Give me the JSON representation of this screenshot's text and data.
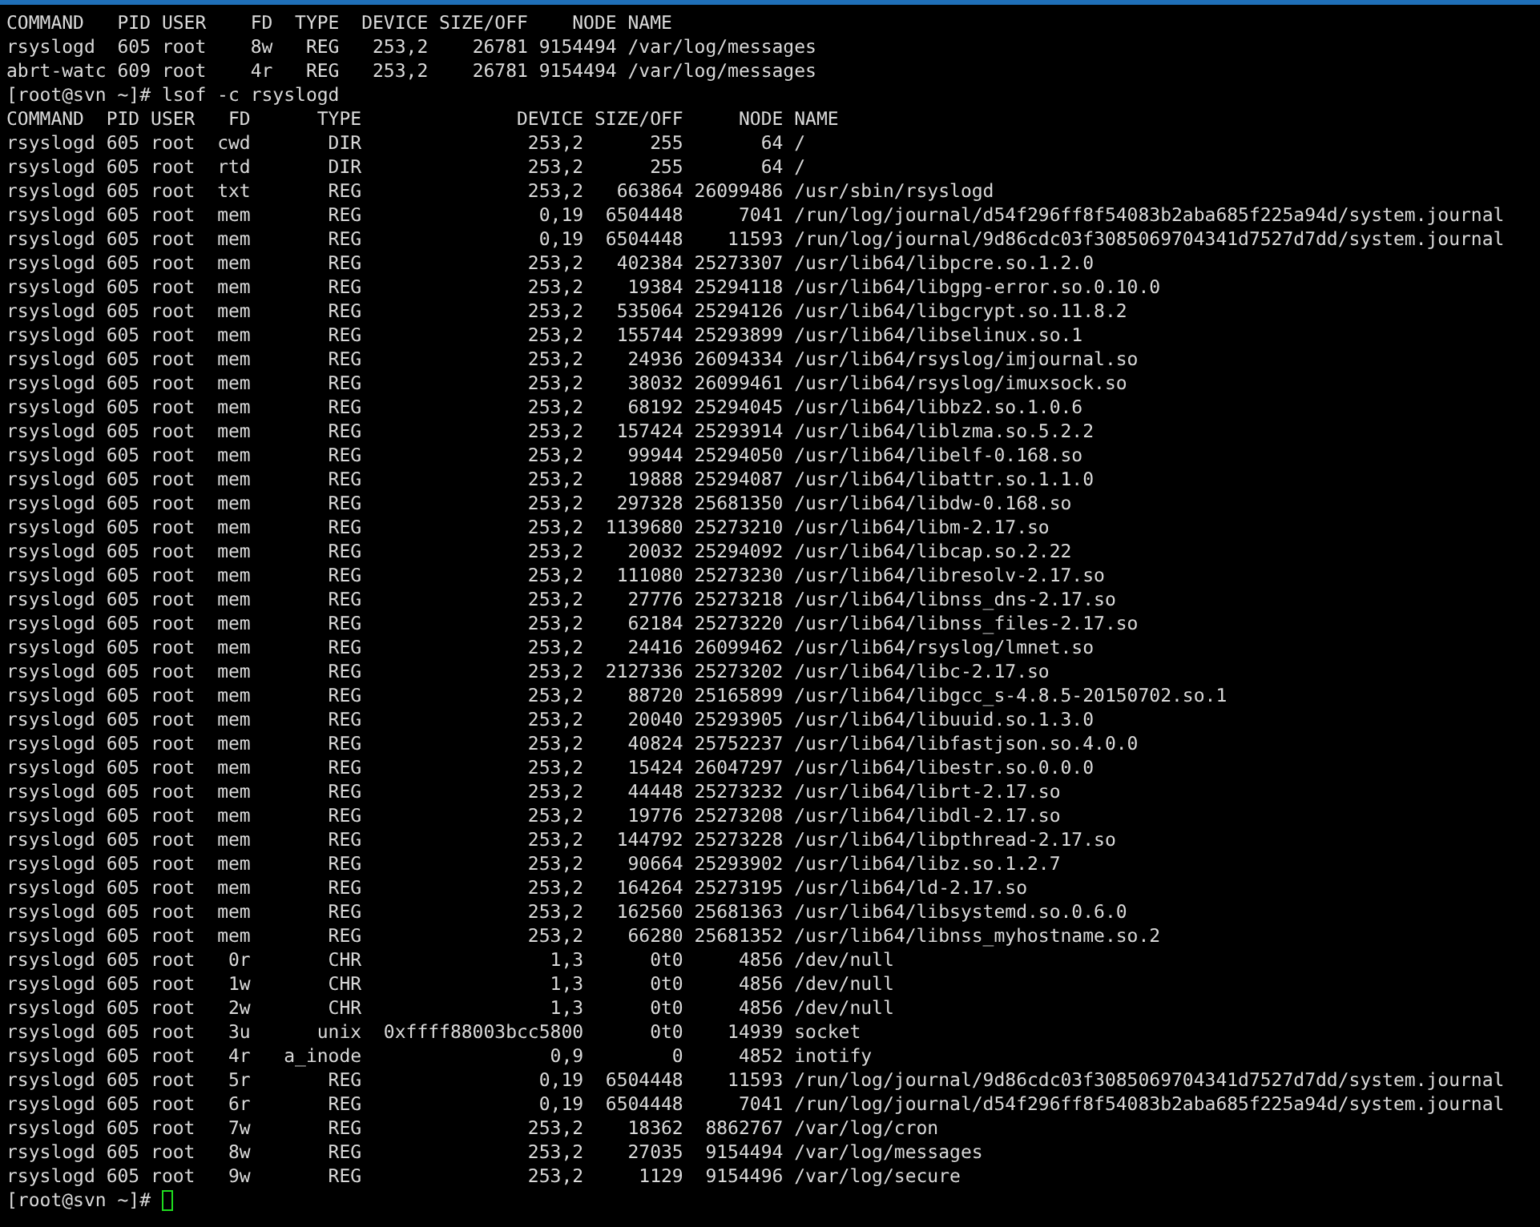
{
  "terminal": {
    "blocks": [
      {
        "kind": "table",
        "columns": [
          "COMMAND",
          "PID",
          "USER",
          "FD",
          "TYPE",
          "DEVICE",
          "SIZE/OFF",
          "NODE",
          "NAME"
        ],
        "rows": [
          [
            "rsyslogd",
            "605",
            "root",
            "8w",
            "REG",
            "253,2",
            "26781",
            "9154494",
            "/var/log/messages"
          ],
          [
            "abrt-watc",
            "609",
            "root",
            "4r",
            "REG",
            "253,2",
            "26781",
            "9154494",
            "/var/log/messages"
          ]
        ]
      },
      {
        "kind": "command_line",
        "prompt": "[root@svn ~]#",
        "command": "lsof -c rsyslogd"
      },
      {
        "kind": "table",
        "columns": [
          "COMMAND",
          "PID",
          "USER",
          "FD",
          "TYPE",
          "DEVICE",
          "SIZE/OFF",
          "NODE",
          "NAME"
        ],
        "rows": [
          [
            "rsyslogd",
            "605",
            "root",
            "cwd",
            "DIR",
            "253,2",
            "255",
            "64",
            "/"
          ],
          [
            "rsyslogd",
            "605",
            "root",
            "rtd",
            "DIR",
            "253,2",
            "255",
            "64",
            "/"
          ],
          [
            "rsyslogd",
            "605",
            "root",
            "txt",
            "REG",
            "253,2",
            "663864",
            "26099486",
            "/usr/sbin/rsyslogd"
          ],
          [
            "rsyslogd",
            "605",
            "root",
            "mem",
            "REG",
            "0,19",
            "6504448",
            "7041",
            "/run/log/journal/d54f296ff8f54083b2aba685f225a94d/system.journal"
          ],
          [
            "rsyslogd",
            "605",
            "root",
            "mem",
            "REG",
            "0,19",
            "6504448",
            "11593",
            "/run/log/journal/9d86cdc03f3085069704341d7527d7dd/system.journal"
          ],
          [
            "rsyslogd",
            "605",
            "root",
            "mem",
            "REG",
            "253,2",
            "402384",
            "25273307",
            "/usr/lib64/libpcre.so.1.2.0"
          ],
          [
            "rsyslogd",
            "605",
            "root",
            "mem",
            "REG",
            "253,2",
            "19384",
            "25294118",
            "/usr/lib64/libgpg-error.so.0.10.0"
          ],
          [
            "rsyslogd",
            "605",
            "root",
            "mem",
            "REG",
            "253,2",
            "535064",
            "25294126",
            "/usr/lib64/libgcrypt.so.11.8.2"
          ],
          [
            "rsyslogd",
            "605",
            "root",
            "mem",
            "REG",
            "253,2",
            "155744",
            "25293899",
            "/usr/lib64/libselinux.so.1"
          ],
          [
            "rsyslogd",
            "605",
            "root",
            "mem",
            "REG",
            "253,2",
            "24936",
            "26094334",
            "/usr/lib64/rsyslog/imjournal.so"
          ],
          [
            "rsyslogd",
            "605",
            "root",
            "mem",
            "REG",
            "253,2",
            "38032",
            "26099461",
            "/usr/lib64/rsyslog/imuxsock.so"
          ],
          [
            "rsyslogd",
            "605",
            "root",
            "mem",
            "REG",
            "253,2",
            "68192",
            "25294045",
            "/usr/lib64/libbz2.so.1.0.6"
          ],
          [
            "rsyslogd",
            "605",
            "root",
            "mem",
            "REG",
            "253,2",
            "157424",
            "25293914",
            "/usr/lib64/liblzma.so.5.2.2"
          ],
          [
            "rsyslogd",
            "605",
            "root",
            "mem",
            "REG",
            "253,2",
            "99944",
            "25294050",
            "/usr/lib64/libelf-0.168.so"
          ],
          [
            "rsyslogd",
            "605",
            "root",
            "mem",
            "REG",
            "253,2",
            "19888",
            "25294087",
            "/usr/lib64/libattr.so.1.1.0"
          ],
          [
            "rsyslogd",
            "605",
            "root",
            "mem",
            "REG",
            "253,2",
            "297328",
            "25681350",
            "/usr/lib64/libdw-0.168.so"
          ],
          [
            "rsyslogd",
            "605",
            "root",
            "mem",
            "REG",
            "253,2",
            "1139680",
            "25273210",
            "/usr/lib64/libm-2.17.so"
          ],
          [
            "rsyslogd",
            "605",
            "root",
            "mem",
            "REG",
            "253,2",
            "20032",
            "25294092",
            "/usr/lib64/libcap.so.2.22"
          ],
          [
            "rsyslogd",
            "605",
            "root",
            "mem",
            "REG",
            "253,2",
            "111080",
            "25273230",
            "/usr/lib64/libresolv-2.17.so"
          ],
          [
            "rsyslogd",
            "605",
            "root",
            "mem",
            "REG",
            "253,2",
            "27776",
            "25273218",
            "/usr/lib64/libnss_dns-2.17.so"
          ],
          [
            "rsyslogd",
            "605",
            "root",
            "mem",
            "REG",
            "253,2",
            "62184",
            "25273220",
            "/usr/lib64/libnss_files-2.17.so"
          ],
          [
            "rsyslogd",
            "605",
            "root",
            "mem",
            "REG",
            "253,2",
            "24416",
            "26099462",
            "/usr/lib64/rsyslog/lmnet.so"
          ],
          [
            "rsyslogd",
            "605",
            "root",
            "mem",
            "REG",
            "253,2",
            "2127336",
            "25273202",
            "/usr/lib64/libc-2.17.so"
          ],
          [
            "rsyslogd",
            "605",
            "root",
            "mem",
            "REG",
            "253,2",
            "88720",
            "25165899",
            "/usr/lib64/libgcc_s-4.8.5-20150702.so.1"
          ],
          [
            "rsyslogd",
            "605",
            "root",
            "mem",
            "REG",
            "253,2",
            "20040",
            "25293905",
            "/usr/lib64/libuuid.so.1.3.0"
          ],
          [
            "rsyslogd",
            "605",
            "root",
            "mem",
            "REG",
            "253,2",
            "40824",
            "25752237",
            "/usr/lib64/libfastjson.so.4.0.0"
          ],
          [
            "rsyslogd",
            "605",
            "root",
            "mem",
            "REG",
            "253,2",
            "15424",
            "26047297",
            "/usr/lib64/libestr.so.0.0.0"
          ],
          [
            "rsyslogd",
            "605",
            "root",
            "mem",
            "REG",
            "253,2",
            "44448",
            "25273232",
            "/usr/lib64/librt-2.17.so"
          ],
          [
            "rsyslogd",
            "605",
            "root",
            "mem",
            "REG",
            "253,2",
            "19776",
            "25273208",
            "/usr/lib64/libdl-2.17.so"
          ],
          [
            "rsyslogd",
            "605",
            "root",
            "mem",
            "REG",
            "253,2",
            "144792",
            "25273228",
            "/usr/lib64/libpthread-2.17.so"
          ],
          [
            "rsyslogd",
            "605",
            "root",
            "mem",
            "REG",
            "253,2",
            "90664",
            "25293902",
            "/usr/lib64/libz.so.1.2.7"
          ],
          [
            "rsyslogd",
            "605",
            "root",
            "mem",
            "REG",
            "253,2",
            "164264",
            "25273195",
            "/usr/lib64/ld-2.17.so"
          ],
          [
            "rsyslogd",
            "605",
            "root",
            "mem",
            "REG",
            "253,2",
            "162560",
            "25681363",
            "/usr/lib64/libsystemd.so.0.6.0"
          ],
          [
            "rsyslogd",
            "605",
            "root",
            "mem",
            "REG",
            "253,2",
            "66280",
            "25681352",
            "/usr/lib64/libnss_myhostname.so.2"
          ],
          [
            "rsyslogd",
            "605",
            "root",
            "0r",
            "CHR",
            "1,3",
            "0t0",
            "4856",
            "/dev/null"
          ],
          [
            "rsyslogd",
            "605",
            "root",
            "1w",
            "CHR",
            "1,3",
            "0t0",
            "4856",
            "/dev/null"
          ],
          [
            "rsyslogd",
            "605",
            "root",
            "2w",
            "CHR",
            "1,3",
            "0t0",
            "4856",
            "/dev/null"
          ],
          [
            "rsyslogd",
            "605",
            "root",
            "3u",
            "unix",
            "0xffff88003bcc5800",
            "0t0",
            "14939",
            "socket"
          ],
          [
            "rsyslogd",
            "605",
            "root",
            "4r",
            "a_inode",
            "0,9",
            "0",
            "4852",
            "inotify"
          ],
          [
            "rsyslogd",
            "605",
            "root",
            "5r",
            "REG",
            "0,19",
            "6504448",
            "11593",
            "/run/log/journal/9d86cdc03f3085069704341d7527d7dd/system.journal"
          ],
          [
            "rsyslogd",
            "605",
            "root",
            "6r",
            "REG",
            "0,19",
            "6504448",
            "7041",
            "/run/log/journal/d54f296ff8f54083b2aba685f225a94d/system.journal"
          ],
          [
            "rsyslogd",
            "605",
            "root",
            "7w",
            "REG",
            "253,2",
            "18362",
            "8862767",
            "/var/log/cron"
          ],
          [
            "rsyslogd",
            "605",
            "root",
            "8w",
            "REG",
            "253,2",
            "27035",
            "9154494",
            "/var/log/messages"
          ],
          [
            "rsyslogd",
            "605",
            "root",
            "9w",
            "REG",
            "253,2",
            "1129",
            "9154496",
            "/var/log/secure"
          ]
        ]
      },
      {
        "kind": "command_line",
        "prompt": "[root@svn ~]#",
        "cursor": true
      }
    ]
  }
}
